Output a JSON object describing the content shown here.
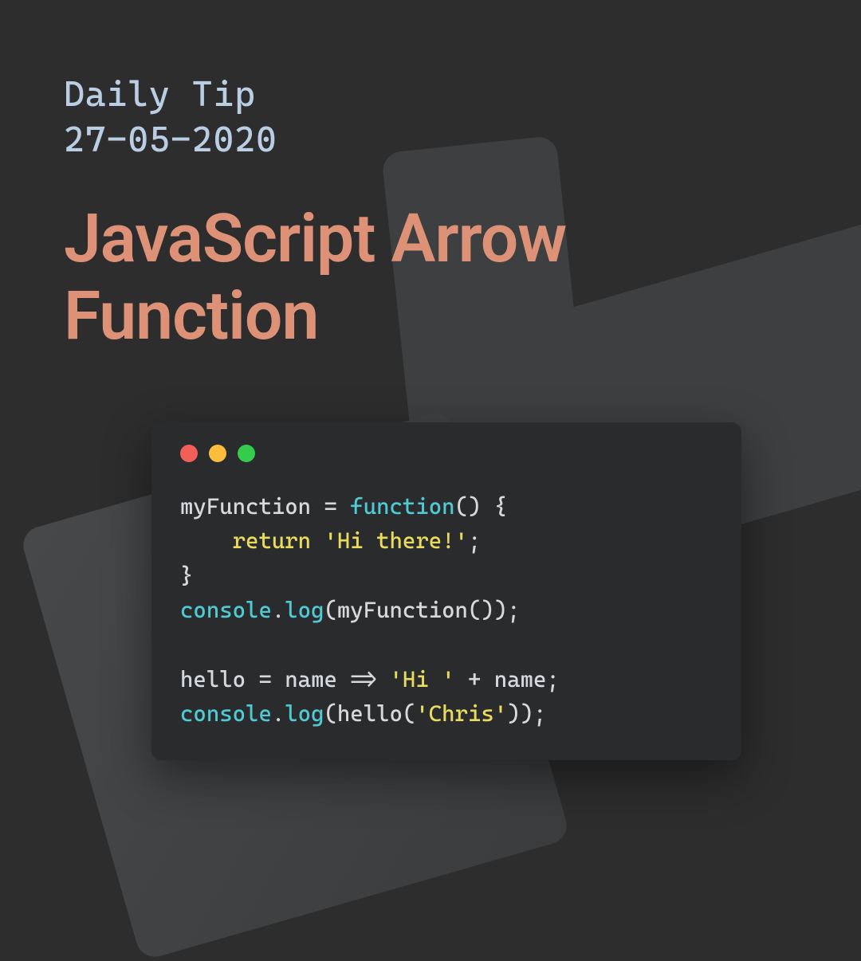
{
  "header": {
    "daily_tip_label": "Daily Tip",
    "date": "27-05-2020"
  },
  "title": "JavaScript Arrow Function",
  "code": {
    "line1": {
      "t1": "myFunction = ",
      "t2": "function",
      "t3": "() {"
    },
    "line2": {
      "indent": "    ",
      "t1": "return ",
      "t2": "'Hi there!'",
      "t3": ";"
    },
    "line3": {
      "t1": "}"
    },
    "line4": {
      "t1": "console",
      "t2": ".",
      "t3": "log",
      "t4": "(myFunction());"
    },
    "line5": {
      "blank": " "
    },
    "line6": {
      "t1": "hello = name => ",
      "t2": "'Hi '",
      "t3": " + name;"
    },
    "line7": {
      "t1": "console",
      "t2": ".",
      "t3": "log",
      "t4": "(hello(",
      "t5": "'Chris'",
      "t6": "));"
    }
  },
  "colors": {
    "background": "#2d2d2d",
    "daily_tip_text": "#b9cee3",
    "title_text": "#dd9176",
    "code_window_bg": "#2a2b2d",
    "code_plain": "#d6d9dc",
    "code_keyword": "#4fcad2",
    "code_string": "#e9db5d",
    "traffic_red": "#f25f58",
    "traffic_yellow": "#fbbe3c",
    "traffic_green": "#35cc4b"
  }
}
